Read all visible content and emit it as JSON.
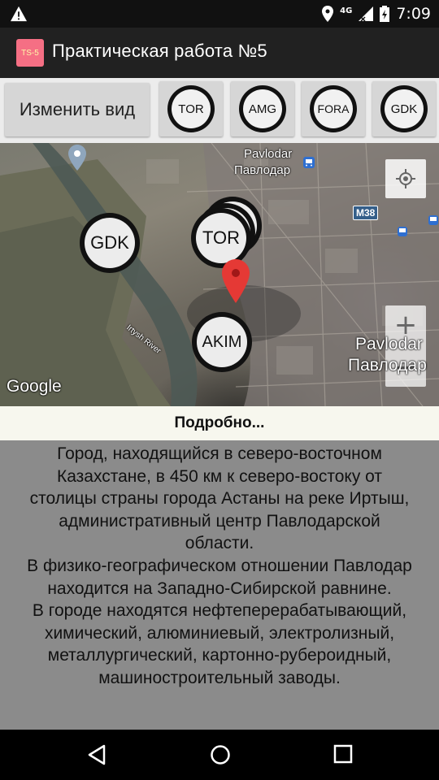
{
  "status_bar": {
    "network": "4G",
    "time": "7:09",
    "icons": [
      "warning-icon",
      "location-icon",
      "signal-icon",
      "battery-icon"
    ]
  },
  "app_bar": {
    "logo_text": "TS-5",
    "title": "Практическая работа №5"
  },
  "toolbar": {
    "change_view_label": "Изменить вид",
    "place_buttons": [
      "TOR",
      "AMG",
      "FORA",
      "GDK"
    ]
  },
  "map": {
    "city_label_en": "Pavlodar",
    "city_label_ru": "Павлодар",
    "river_label": "Irtysh River",
    "road_label": "M38",
    "city_label_en_right": "Pavlodar",
    "city_label_ru_right": "Павлодар",
    "markers": [
      "GDK",
      "TOR",
      "AKIM"
    ],
    "attribution": "Google",
    "zoom_in": "+",
    "zoom_out": "−"
  },
  "details": {
    "header": "Подробно...",
    "text": "Город, находящийся в северо-восточном\nКазахстане, в 450 км к северо-востоку от\nстолицы страны города Астаны на реке Иртыш,\nадминистративный центр Павлодарской\nобласти.\nВ физико-географическом отношении Павлодар\nнаходится на Западно-Сибирской равнине.\nВ городе находятся нефтеперерабатывающий,\nхимический, алюминиевый, электролизный,\nметаллургический, картонно-рубероидный,\nмашиностроительный заводы."
  },
  "colors": {
    "app_bar": "#212121",
    "logo_bg": "#f56f84",
    "description_bg": "#8b8b8b",
    "details_header_bg": "#f7f7ee",
    "map_pin": "#e53935"
  }
}
